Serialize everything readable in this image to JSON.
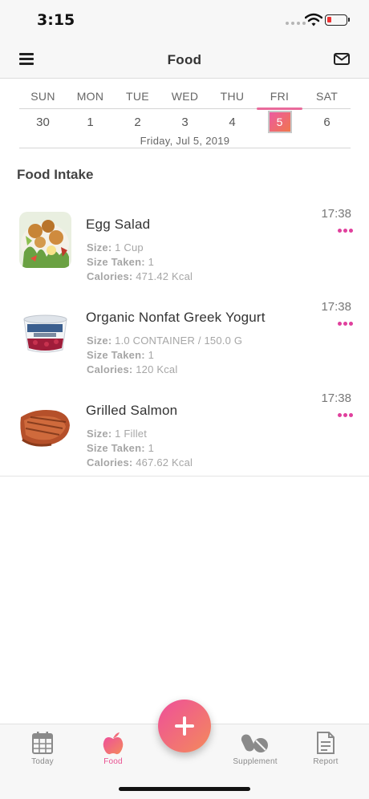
{
  "status_bar": {
    "time": "3:15"
  },
  "nav": {
    "title": "Food",
    "menu_icon": "hamburger-icon",
    "mail_icon": "mail-icon"
  },
  "calendar": {
    "days": [
      {
        "name": "SUN",
        "num": "30"
      },
      {
        "name": "MON",
        "num": "1"
      },
      {
        "name": "TUE",
        "num": "2"
      },
      {
        "name": "WED",
        "num": "3"
      },
      {
        "name": "THU",
        "num": "4"
      },
      {
        "name": "FRI",
        "num": "5"
      },
      {
        "name": "SAT",
        "num": "6"
      }
    ],
    "selected_day": "FRI",
    "selected_date": "Friday, Jul 5, 2019"
  },
  "food_intake": {
    "title": "Food Intake",
    "size_label": "Size:",
    "size_taken_label": "Size Taken:",
    "calories_label": "Calories:",
    "items": [
      {
        "name": "Egg Salad",
        "size": "1 Cup",
        "size_taken": "1",
        "calories": "471.42 Kcal",
        "time": "17:38"
      },
      {
        "name": "Organic Nonfat Greek Yogurt",
        "size": "1.0 CONTAINER / 150.0 G",
        "size_taken": "1",
        "calories": "120 Kcal",
        "time": "17:38"
      },
      {
        "name": "Grilled Salmon",
        "size": "1 Fillet",
        "size_taken": "1",
        "calories": "467.62 Kcal",
        "time": "17:38"
      }
    ]
  },
  "tab_bar": {
    "tabs": [
      {
        "label": "Today",
        "icon": "calendar-icon"
      },
      {
        "label": "Food",
        "icon": "apple-icon",
        "active": true
      },
      {
        "label": "Supplement",
        "icon": "pills-icon"
      },
      {
        "label": "Report",
        "icon": "document-icon"
      }
    ],
    "add_button_icon": "plus-icon"
  },
  "colors": {
    "accent": "#e94f90",
    "accent_end": "#f0774c"
  }
}
